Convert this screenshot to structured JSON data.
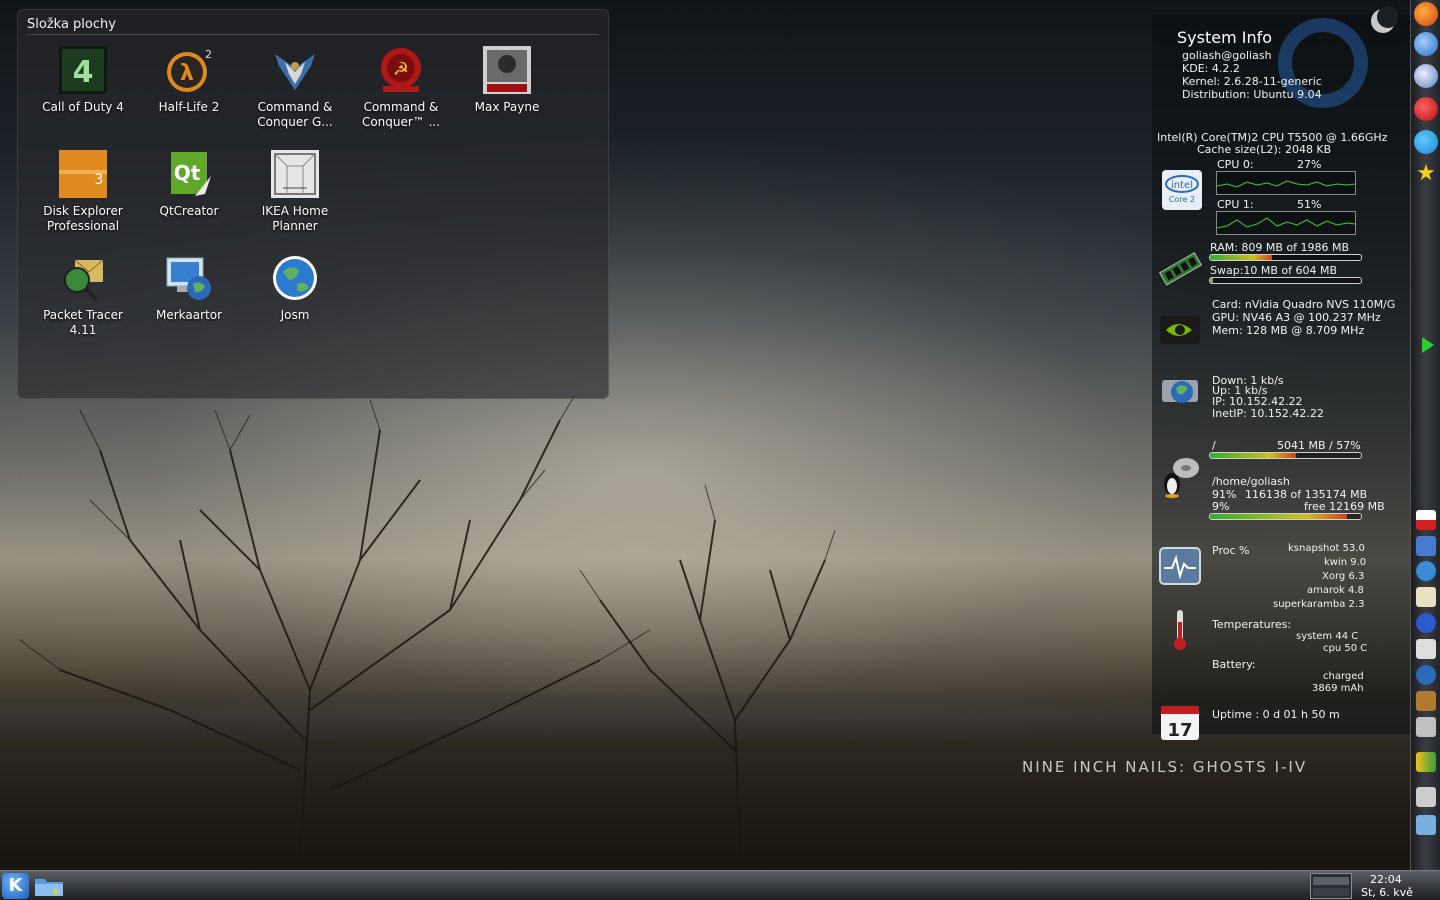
{
  "folder_view": {
    "title": "Složka plochy",
    "icons": [
      {
        "label": "Call of Duty 4",
        "icon": "call-of-duty-4-icon"
      },
      {
        "label": "Half-Life 2",
        "icon": "half-life-2-icon"
      },
      {
        "label": "Command & Conquer G...",
        "icon": "command-conquer-generals-icon"
      },
      {
        "label": "Command & Conquer™ ...",
        "icon": "red-alert-3-icon"
      },
      {
        "label": "Max Payne",
        "icon": "max-payne-icon"
      },
      {
        "label": "Disk Explorer Professional",
        "icon": "disk-explorer-icon"
      },
      {
        "label": "QtCreator",
        "icon": "qt-creator-icon"
      },
      {
        "label": "IKEA Home Planner",
        "icon": "ikea-home-planner-icon"
      },
      {
        "label": "Packet Tracer 4.11",
        "icon": "packet-tracer-icon"
      },
      {
        "label": "Merkaartor",
        "icon": "merkaartor-icon"
      },
      {
        "label": "Josm",
        "icon": "josm-icon"
      }
    ]
  },
  "sysinfo": {
    "title": "System Info",
    "user": "goliash@goliash",
    "kde": "KDE: 4.2.2",
    "kernel": "Kernel: 2.6.28-11-generic",
    "distribution": "Distribution: Ubuntu 9.04",
    "cpu_model": "Intel(R) Core(TM)2 CPU T5500 @ 1.66GHz",
    "cache": "Cache size(L2): 2048 KB",
    "cpu0": {
      "label": "CPU 0:",
      "value": "27%",
      "level": 0.27
    },
    "cpu1": {
      "label": "CPU 1:",
      "value": "51%",
      "level": 0.51
    },
    "ram": {
      "text": "RAM:  809 MB  of  1986 MB",
      "level": 0.41
    },
    "swap": {
      "text": "Swap:10 MB     of  604 MB",
      "level": 0.02
    },
    "gpu_card": "Card:  nVidia Quadro NVS 110M/G",
    "gpu_clock": "GPU:  NV46 A3 @ 100.237 MHz",
    "gpu_mem": "Mem: 128 MB @ 8.709 MHz",
    "net_down": "Down:  1 kb/s",
    "net_up": "Up:     1 kb/s",
    "net_ip": "IP:       10.152.42.22",
    "net_inetip": "InetIP: 10.152.42.22",
    "root_fs": {
      "mount": "/",
      "usage": "5041 MB / 57%",
      "level": 0.57
    },
    "home_fs": {
      "mount": "/home/goliash",
      "used_line_pct": "91%",
      "used_line": "116138 of 135174 MB",
      "free_line_pct": "9%",
      "free_line": "free 12169 MB",
      "level": 0.91
    },
    "proc_label": "Proc %",
    "processes": [
      "ksnapshot 53.0",
      "kwin 9.0",
      "Xorg 6.3",
      "amarok 4.8",
      "superkaramba 2.3"
    ],
    "temperatures_label": "Temperatures:",
    "temp_system": "system   44 C",
    "temp_cpu": "cpu   50 C",
    "battery_label": "Battery:",
    "battery_state": "charged",
    "battery_capacity": "3869 mAh",
    "uptime": "Uptime :    0 d 01 h 50 m",
    "calendar_day": "17"
  },
  "wallpaper_text": "NINE INCH NAILS: GHOSTS I-IV",
  "taskbar": {
    "time": "22:04",
    "date": "St, 6. kvě"
  },
  "dock": {
    "items": [
      "firefox-icon",
      "kmail-icon",
      "chrome-icon",
      "opera-icon",
      "skype-icon",
      "favorites-star-icon",
      "expand-arrow-icon"
    ],
    "tray": [
      "keyboard-layout-icon",
      "klipper-icon",
      "network-icon",
      "clipboard-icon",
      "bluetooth-icon",
      "network-disconnected-icon",
      "kopete-icon",
      "suitcase-icon",
      "volume-icon",
      "battery-icon",
      "usb-device-icon",
      "display-icon"
    ]
  },
  "colors": {
    "accent_blue": "#1c5fb6",
    "bar_green": "#2fae2f",
    "bar_red": "#d04020"
  }
}
